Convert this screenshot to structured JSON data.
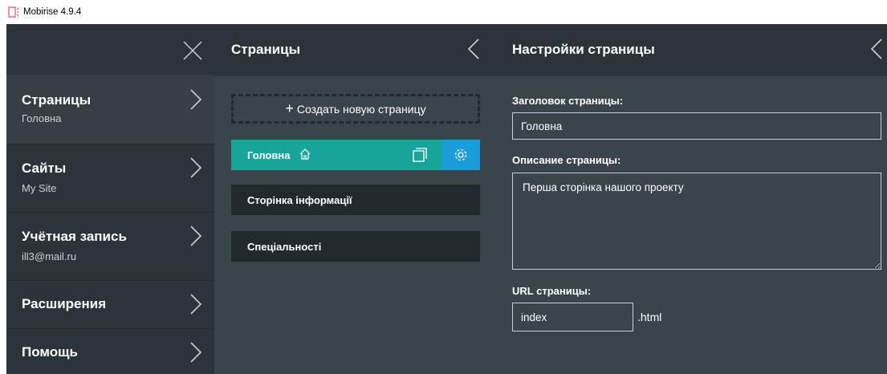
{
  "window": {
    "title": "Mobirise 4.9.4",
    "app_icon": "mobirise-logo-icon"
  },
  "menu": {
    "close_icon": "close-icon",
    "items": [
      {
        "label": "Страницы",
        "sub": "Головна"
      },
      {
        "label": "Сайты",
        "sub": "My Site"
      },
      {
        "label": "Учётная запись",
        "sub": "ill3@mail.ru"
      },
      {
        "label": "Расширения"
      },
      {
        "label": "Помощь"
      }
    ]
  },
  "pages_panel": {
    "title": "Страницы",
    "create_label": "Создать новую страницу",
    "pages": [
      {
        "name": "Головна",
        "home": true
      },
      {
        "name": "Сторінка інформації"
      },
      {
        "name": "Спеціальності"
      }
    ]
  },
  "settings_panel": {
    "title": "Настройки страницы",
    "page_title_label": "Заголовок страницы:",
    "page_title_value": "Головна",
    "description_label": "Описание страницы:",
    "description_value": "Перша сторінка нашого проекту",
    "url_label": "URL страницы:",
    "url_value": "index",
    "url_suffix": ".html"
  },
  "colors": {
    "dark": "#2b3439",
    "panel": "#39454b",
    "active_page": "#17a59a",
    "gear_accent": "#1a9ed9"
  }
}
